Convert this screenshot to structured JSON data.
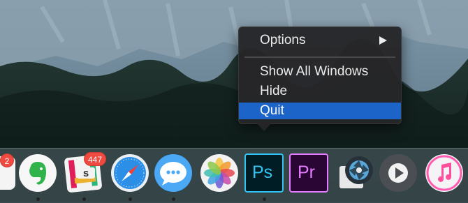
{
  "context_menu": {
    "items": [
      {
        "label": "Options",
        "has_submenu": true
      },
      {
        "label": "Show All Windows"
      },
      {
        "label": "Hide"
      },
      {
        "label": "Quit",
        "selected": true
      }
    ]
  },
  "dock": {
    "apps": [
      {
        "icon": "calendar-icon",
        "badge": "2",
        "running": false
      },
      {
        "icon": "evernote-icon",
        "running": true
      },
      {
        "icon": "slack-icon",
        "badge": "447",
        "running": true
      },
      {
        "icon": "safari-icon",
        "running": true
      },
      {
        "icon": "messages-icon",
        "running": true
      },
      {
        "icon": "photos-icon",
        "running": false
      },
      {
        "icon": "photoshop-icon",
        "label": "Ps",
        "running": true
      },
      {
        "icon": "premiere-icon",
        "label": "Pr",
        "running": false
      },
      {
        "icon": "aperture-icon",
        "running": false
      },
      {
        "icon": "quicktime-icon",
        "running": false
      },
      {
        "icon": "itunes-icon",
        "running": false
      }
    ]
  },
  "colors": {
    "menu_highlight": "#1c64c7",
    "badge": "#f04a40",
    "photoshop_accent": "#31c5f4",
    "premiere_accent": "#e57bff"
  }
}
